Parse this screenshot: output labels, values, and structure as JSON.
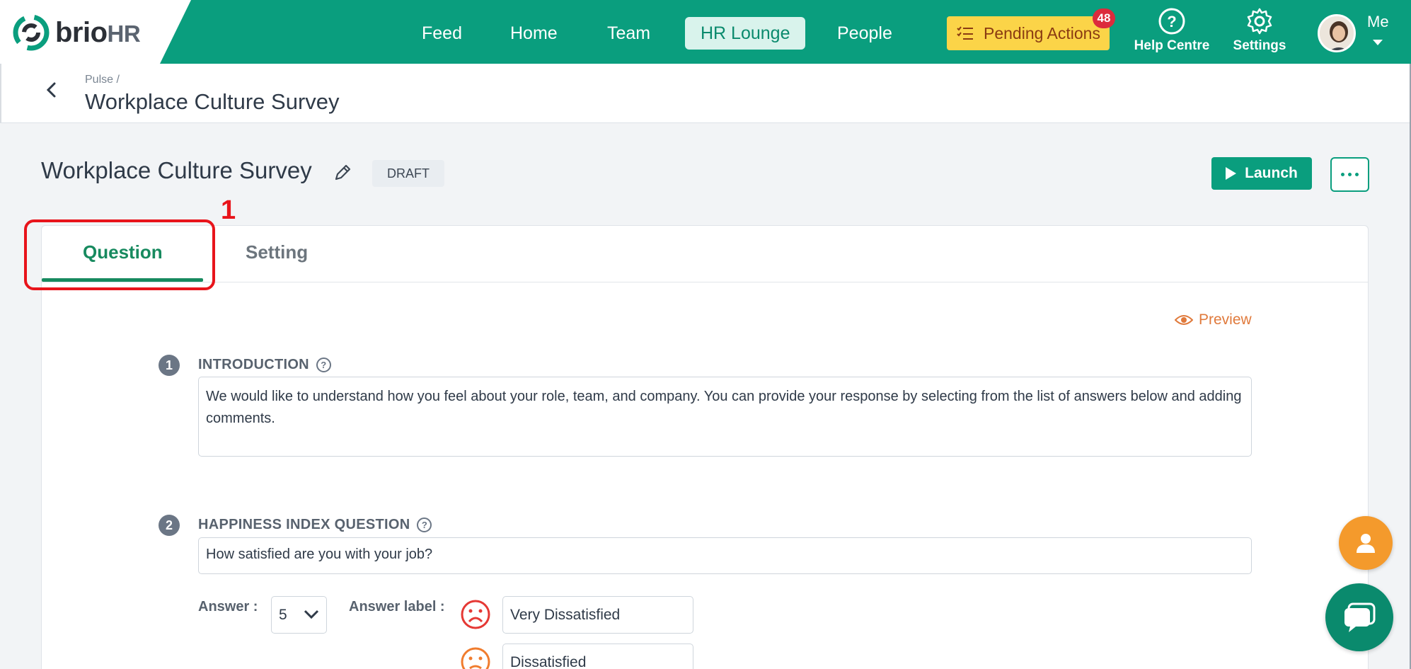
{
  "brand": {
    "name": "brio",
    "suffix": "HR"
  },
  "nav": {
    "items": [
      {
        "label": "Feed"
      },
      {
        "label": "Home"
      },
      {
        "label": "Team"
      },
      {
        "label": "HR Lounge",
        "active": true
      },
      {
        "label": "People"
      }
    ],
    "pending_label": "Pending Actions",
    "pending_count": "48",
    "help_label": "Help Centre",
    "settings_label": "Settings",
    "me_label": "Me"
  },
  "breadcrumb": {
    "parent": "Pulse /",
    "title": "Workplace Culture Survey"
  },
  "survey": {
    "title": "Workplace Culture Survey",
    "status": "DRAFT",
    "launch_label": "Launch"
  },
  "tabs": [
    {
      "label": "Question",
      "active": true
    },
    {
      "label": "Setting"
    }
  ],
  "annotation": {
    "step": "1"
  },
  "preview_label": "Preview",
  "questions": {
    "intro": {
      "number": "1",
      "label": "INTRODUCTION",
      "value": "We would like to understand how you feel about your role, team, and company. You can provide your response by selecting from the list of answers below and adding comments."
    },
    "happiness": {
      "number": "2",
      "label": "HAPPINESS INDEX QUESTION",
      "value": "How satisfied are you with your job?",
      "answer_label": "Answer :",
      "answer_count": "5",
      "answer_labels_label": "Answer label :",
      "answers": [
        {
          "text": "Very Dissatisfied",
          "icon": "very-dissatisfied-face-icon",
          "color": "#e53935"
        },
        {
          "text": "Dissatisfied",
          "icon": "dissatisfied-face-icon",
          "color": "#f07c2e"
        }
      ]
    }
  },
  "colors": {
    "brand": "#0a9e7e",
    "pending": "#fbd448",
    "annotation": "#e8141b",
    "preview": "#e07a3c"
  }
}
